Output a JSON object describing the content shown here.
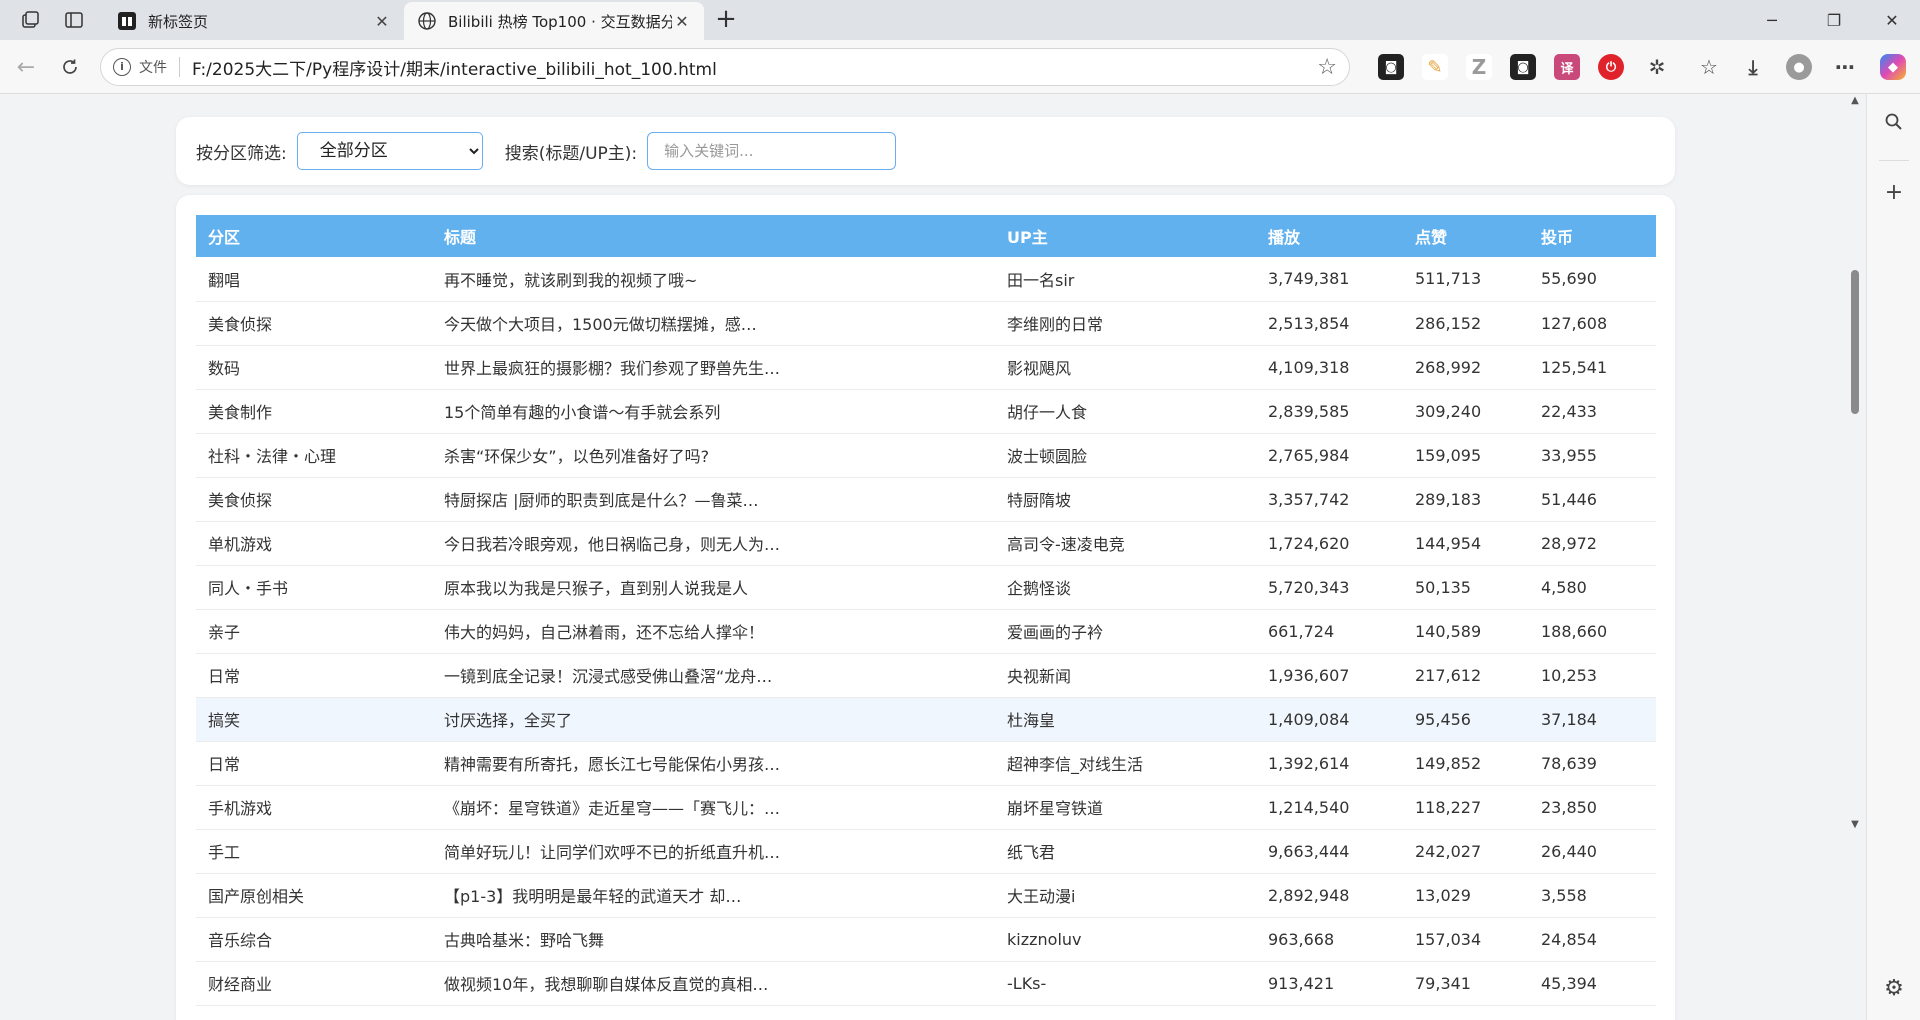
{
  "browser": {
    "tabs": [
      {
        "label": "新标签页",
        "close": "✕"
      },
      {
        "label": "Bilibili 热榜 Top100 · 交互数据分析",
        "close": "✕"
      }
    ],
    "new_tab": "+",
    "window_controls": {
      "minimize": "─",
      "restore": "❐",
      "close": "✕"
    },
    "address": {
      "scheme_label": "文件",
      "url": "F:/2025大二下/Py程序设计/期末/interactive_bilibili_hot_100.html"
    },
    "extensions": [
      {
        "name": "ext-1",
        "glyph": "◙",
        "color": "#222222"
      },
      {
        "name": "ext-2",
        "glyph": "✎",
        "color": "#e8a33a"
      },
      {
        "name": "ext-3",
        "glyph": "Z",
        "color": "#9a9a9a"
      },
      {
        "name": "ext-4",
        "glyph": "◙",
        "color": "#222222"
      },
      {
        "name": "ext-5",
        "glyph": "译",
        "color": "#c94a7a"
      },
      {
        "name": "ext-6",
        "glyph": "⏻",
        "color": "#e0232b"
      }
    ]
  },
  "filters": {
    "category_label": "按分区筛选:",
    "category_selected": "全部分区",
    "search_label": "搜索(标题/UP主):",
    "search_placeholder": "输入关键词..."
  },
  "table": {
    "headers": [
      "分区",
      "标题",
      "UP主",
      "播放",
      "点赞",
      "投币"
    ],
    "rows": [
      [
        "翻唱",
        "再不睡觉，就该刷到我的视频了哦~",
        "田一名sir",
        "3,749,381",
        "511,713",
        "55,690"
      ],
      [
        "美食侦探",
        "今天做个大项目，1500元做切糕摆摊，感…",
        "李维刚的日常",
        "2,513,854",
        "286,152",
        "127,608"
      ],
      [
        "数码",
        "世界上最疯狂的摄影棚？我们参观了野兽先生…",
        "影视飓风",
        "4,109,318",
        "268,992",
        "125,541"
      ],
      [
        "美食制作",
        "15个简单有趣的小食谱～有手就会系列",
        "胡仔一人食",
        "2,839,585",
        "309,240",
        "22,433"
      ],
      [
        "社科・法律・心理",
        "杀害“环保少女”，以色列准备好了吗?",
        "波士顿圆脸",
        "2,765,984",
        "159,095",
        "33,955"
      ],
      [
        "美食侦探",
        "特厨探店 |厨师的职责到底是什么？—鲁菜…",
        "特厨隋坡",
        "3,357,742",
        "289,183",
        "51,446"
      ],
      [
        "单机游戏",
        "今日我若冷眼旁观，他日祸临己身，则无人为…",
        "高司令-速凌电竞",
        "1,724,620",
        "144,954",
        "28,972"
      ],
      [
        "同人・手书",
        "原本我以为我是只猴子，直到别人说我是人",
        "企鹅怪谈",
        "5,720,343",
        "50,135",
        "4,580"
      ],
      [
        "亲子",
        "伟大的妈妈，自己淋着雨，还不忘给人撑伞！",
        "爱画画的子衿",
        "661,724",
        "140,589",
        "188,660"
      ],
      [
        "日常",
        "一镜到底全记录！沉浸式感受佛山叠滘“龙舟…",
        "央视新闻",
        "1,936,607",
        "217,612",
        "10,253"
      ],
      [
        "搞笑",
        "讨厌选择，全买了",
        "杜海皇",
        "1,409,084",
        "95,456",
        "37,184"
      ],
      [
        "日常",
        "精神需要有所寄托，愿长江七号能保佑小男孩…",
        "超神李信_对线生活",
        "1,392,614",
        "149,852",
        "78,639"
      ],
      [
        "手机游戏",
        "《崩坏：星穹铁道》走近星穹——「赛飞儿：…",
        "崩坏星穹铁道",
        "1,214,540",
        "118,227",
        "23,850"
      ],
      [
        "手工",
        "简单好玩儿！让同学们欢呼不已的折纸直升机…",
        "纸飞君",
        "9,663,444",
        "242,027",
        "26,440"
      ],
      [
        "国产原创相关",
        "【p1-3】我明明是最年轻的武道天才 却…",
        "大王动漫i",
        "2,892,948",
        "13,029",
        "3,558"
      ],
      [
        "音乐综合",
        "古典哈基米：野哈飞舞",
        "kizznoluv",
        "963,668",
        "157,034",
        "24,854"
      ],
      [
        "财经商业",
        "做视频10年，我想聊聊自媒体反直觉的真相…",
        "-LKs-",
        "913,421",
        "79,341",
        "45,394"
      ]
    ],
    "hover_row_index": 10
  }
}
